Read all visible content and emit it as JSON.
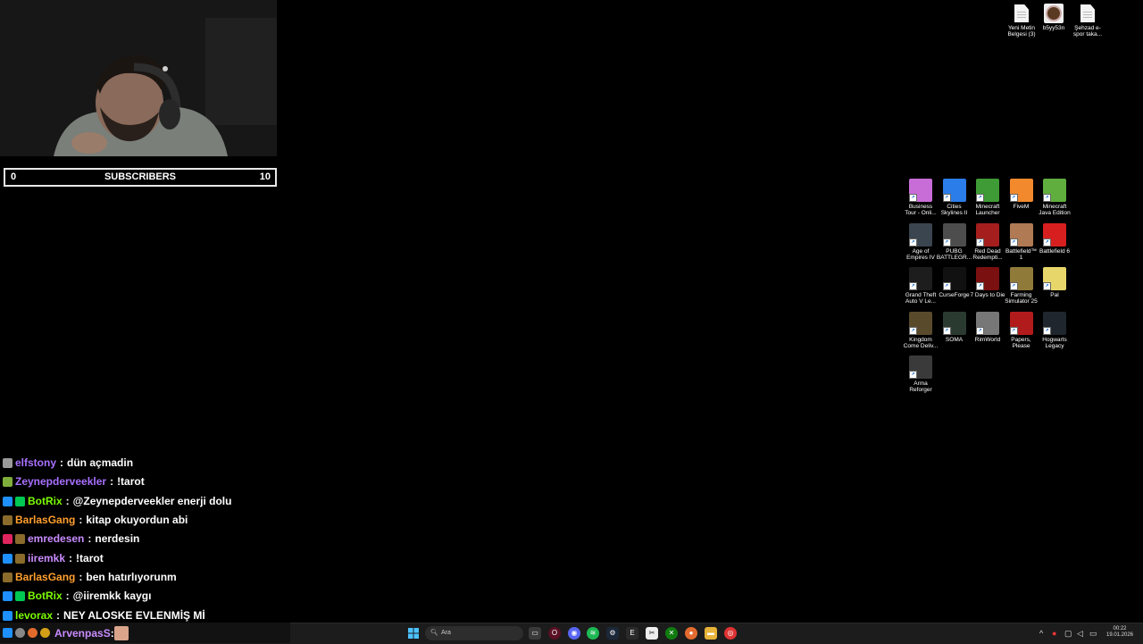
{
  "subscribers": {
    "current": "0",
    "label": "SUBSCRIBERS",
    "goal": "10"
  },
  "desktop_files": [
    {
      "label": "Yeni Metin Belgesi (3)",
      "icon": "text-file-icon"
    },
    {
      "label": "b5yy53n",
      "icon": "image-file-icon"
    },
    {
      "label": "Şehzad e-spor taka...",
      "icon": "text-file-icon"
    }
  ],
  "desktop_apps": [
    {
      "label": "Business Tour - Onli...",
      "icon": "business-tour-icon",
      "color": "#c86dd7"
    },
    {
      "label": "Cities Skylines II",
      "icon": "cities-skylines-icon",
      "color": "#2b7de9"
    },
    {
      "label": "Minecraft Launcher",
      "icon": "minecraft-launcher-icon",
      "color": "#3f9b35"
    },
    {
      "label": "FiveM",
      "icon": "fivem-icon",
      "color": "#f28a2d"
    },
    {
      "label": "Minecraft Java Edition",
      "icon": "minecraft-java-icon",
      "color": "#5fae3e"
    },
    {
      "label": "Age of Empires IV",
      "icon": "age-of-empires-icon",
      "color": "#3b4550"
    },
    {
      "label": "PUBG BATTLEGR...",
      "icon": "pubg-icon",
      "color": "#4d4d4d"
    },
    {
      "label": "Red Dead Redempti...",
      "icon": "red-dead-icon",
      "color": "#a41e1e"
    },
    {
      "label": "Battlefield™ 1",
      "icon": "battlefield-1-icon",
      "color": "#b07a55"
    },
    {
      "label": "Battlefield 6",
      "icon": "battlefield-6-icon",
      "color": "#d81f1f"
    },
    {
      "label": "Grand Theft Auto V Le...",
      "icon": "gta-v-icon",
      "color": "#1d1d1d"
    },
    {
      "label": "CurseForge",
      "icon": "curseforge-icon",
      "color": "#111111"
    },
    {
      "label": "7 Days to Die",
      "icon": "seven-days-icon",
      "color": "#7a1010"
    },
    {
      "label": "Farming Simulator 25",
      "icon": "farming-simulator-icon",
      "color": "#8f7a3a"
    },
    {
      "label": "Pal",
      "icon": "pal-icon",
      "color": "#e7d76a"
    },
    {
      "label": "Kingdom Come Deliv...",
      "icon": "kingdom-come-icon",
      "color": "#5a4a2c"
    },
    {
      "label": "SOMA",
      "icon": "soma-icon",
      "color": "#2b3a30"
    },
    {
      "label": "RimWorld",
      "icon": "rimworld-icon",
      "color": "#777777"
    },
    {
      "label": "Papers, Please",
      "icon": "papers-please-icon",
      "color": "#b21b1b"
    },
    {
      "label": "Hogwarts Legacy",
      "icon": "hogwarts-legacy-icon",
      "color": "#20262e"
    },
    {
      "label": "Arma Reforger",
      "icon": "arma-reforger-icon",
      "color": "#3a3a3a"
    }
  ],
  "chat": [
    {
      "user": "elfstony",
      "color": "#a970ff",
      "text": "dün açmadin",
      "badges": [
        "#9a9a9a"
      ]
    },
    {
      "user": "Zeynepderveekler",
      "color": "#a970ff",
      "text": "!tarot",
      "badges": [
        "#7fae3a"
      ]
    },
    {
      "user": "BotRix",
      "color": "#7cfc00",
      "text": "@Zeynepderveekler enerji dolu",
      "badges": [
        "#1e90ff",
        "#00c853"
      ]
    },
    {
      "user": "BarlasGang",
      "color": "#ff9f2e",
      "text": "kitap okuyordun abi",
      "badges": [
        "#8a6b2c"
      ]
    },
    {
      "user": "emredesen",
      "color": "#c98cff",
      "text": "nerdesin",
      "badges": [
        "#e0245e",
        "#8a6b2c"
      ]
    },
    {
      "user": "iiremkk",
      "color": "#c98cff",
      "text": "!tarot",
      "badges": [
        "#1e90ff",
        "#8a6b2c"
      ]
    },
    {
      "user": "BarlasGang",
      "color": "#ff9f2e",
      "text": "ben hatırlıyorunm",
      "badges": [
        "#8a6b2c"
      ]
    },
    {
      "user": "BotRix",
      "color": "#7cfc00",
      "text": "@iiremkk kaygı",
      "badges": [
        "#1e90ff",
        "#00c853"
      ]
    },
    {
      "user": "levorax",
      "color": "#7cfc00",
      "text": "NEY ALOSKE EVLENMİŞ Mİ",
      "badges": [
        "#1e90ff"
      ]
    }
  ],
  "last_message": {
    "user": "ArvenpasS",
    "color": "#c98cff",
    "separator": ":"
  },
  "taskbar": {
    "search_placeholder": "Ara",
    "time": "00:22",
    "date": "19.01.2026"
  }
}
